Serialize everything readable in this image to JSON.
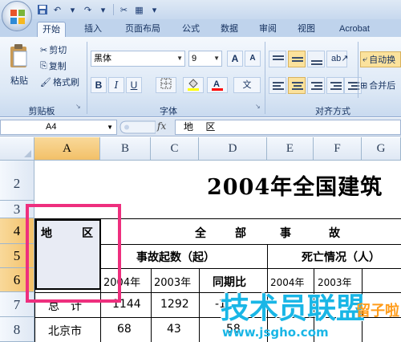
{
  "ribbon_tabs": [
    "开始",
    "插入",
    "页面布局",
    "公式",
    "数据",
    "审阅",
    "视图",
    "Acrobat"
  ],
  "clipboard": {
    "paste": "粘贴",
    "cut": "剪切",
    "copy": "复制",
    "format_painter": "格式刷",
    "label": "剪贴板"
  },
  "font": {
    "name": "黑体",
    "size": "9",
    "grow": "A",
    "shrink": "A",
    "wen": "文",
    "bold": "B",
    "italic": "I",
    "underline": "U",
    "label": "字体"
  },
  "alignment": {
    "wrap": "自动换",
    "merge": "合并后",
    "label": "对齐方式"
  },
  "colors": {
    "fill_color": "#ffff00",
    "font_color": "#ff0000",
    "highlight": "#ee2f7e",
    "watermark": "#19b6e6"
  },
  "formula_bar": {
    "name_box": "A4",
    "fx": "fx",
    "content": "地 区"
  },
  "columns": [
    "A",
    "B",
    "C",
    "D",
    "E",
    "F",
    "G"
  ],
  "rows": [
    "2",
    "3",
    "4",
    "5",
    "6",
    "7",
    "8"
  ],
  "sheet": {
    "title": "2004年全国建筑",
    "a4_left": "地",
    "a4_right": "区",
    "all_header": [
      "全",
      "部",
      "事",
      "故"
    ],
    "accidents": "事故起数（起）",
    "deaths": "死亡情况（人）",
    "y2004": "2004年",
    "y2003": "2003年",
    "yoy": "同期比",
    "y2004b": "2004年",
    "y2003b": "2003年",
    "r7": {
      "a": "总　计",
      "b": "1144",
      "c": "1292",
      "d": "-1"
    },
    "r8": {
      "a": "北京市",
      "b": "68",
      "c": "43",
      "d": "58"
    }
  },
  "watermark": {
    "main": "技术员联盟",
    "url": "www.jsgho.com",
    "corner": "留子啦"
  }
}
